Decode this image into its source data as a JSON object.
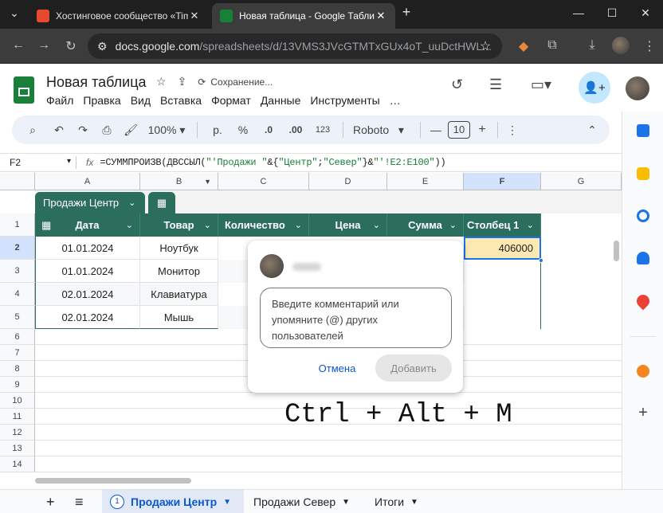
{
  "browser": {
    "tabs": [
      {
        "title": "Хостинговое сообщество «Tim",
        "favicon_color": "#e54a2f"
      },
      {
        "title": "Новая таблица - Google Табли",
        "favicon_color": "#188038"
      }
    ],
    "url_host": "docs.google.com",
    "url_path": "/spreadsheets/d/13VMS3JVcGTMTxGUx4oT_uuDctHWL..."
  },
  "doc": {
    "title": "Новая таблица",
    "status": "Сохранение...",
    "menu": [
      "Файл",
      "Правка",
      "Вид",
      "Вставка",
      "Формат",
      "Данные",
      "Инструменты",
      "…"
    ]
  },
  "toolbar": {
    "zoom": "100%",
    "currency": "р.",
    "percent": "%",
    "dec_less": ".0",
    "dec_more": ".00",
    "number_format": "123",
    "font": "Roboto",
    "font_size": "10",
    "minus": "—",
    "plus": "+"
  },
  "formula_bar": {
    "cell_ref": "F2",
    "fx": "fx",
    "formula_prefix": "=СУММПРОИЗВ(ДВССЫЛ(",
    "formula_str1": "\"'Продажи \"",
    "formula_mid": "&{",
    "formula_str2": "\"Центр\"",
    "formula_sep": ";",
    "formula_str3": "\"Север\"",
    "formula_mid2": "}&",
    "formula_str4": "\"'!E2:E100\"",
    "formula_suffix": "))"
  },
  "grid": {
    "columns": [
      "A",
      "B",
      "C",
      "D",
      "E",
      "F",
      "G"
    ],
    "rows": [
      "1",
      "2",
      "3",
      "4",
      "5",
      "6",
      "7",
      "8",
      "9",
      "10",
      "11",
      "12",
      "13",
      "14"
    ],
    "table_name": "Продажи Центр",
    "headers": [
      "Дата",
      "Товар",
      "Количество",
      "Цена",
      "Сумма",
      "Столбец 1"
    ],
    "data": [
      [
        "01.01.2024",
        "Ноутбук"
      ],
      [
        "01.01.2024",
        "Монитор"
      ],
      [
        "02.01.2024",
        "Клавиатура"
      ],
      [
        "02.01.2024",
        "Мышь"
      ]
    ],
    "f2_value": "406000"
  },
  "comment": {
    "placeholder": "Введите комментарий или упомяните (@) других пользователей",
    "cancel": "Отмена",
    "add": "Добавить"
  },
  "overlay_text": "Ctrl + Alt + M",
  "sheets": {
    "tabs": [
      {
        "index": "1",
        "name": "Продажи Центр"
      },
      {
        "name": "Продажи Север"
      },
      {
        "name": "Итоги"
      }
    ]
  },
  "colors": {
    "table_header": "#2b6e5e",
    "accent": "#0b57d0",
    "selected_cell": "#fce8b2"
  }
}
